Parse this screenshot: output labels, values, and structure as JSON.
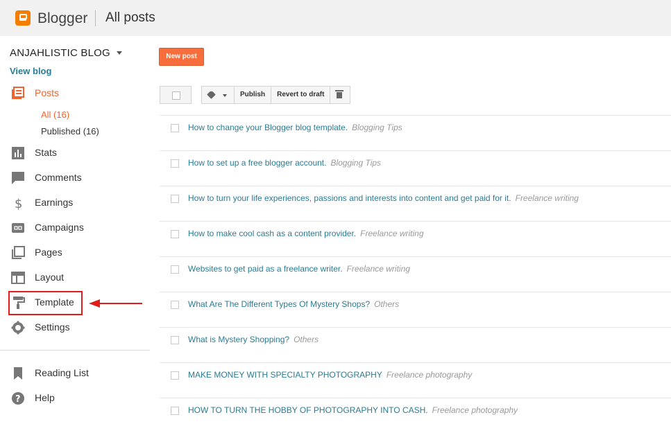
{
  "header": {
    "brand": "Blogger",
    "page_title": "All posts"
  },
  "sidebar": {
    "blog_name": "ANJAHLISTIC BLOG",
    "view_blog": "View blog",
    "posts": "Posts",
    "sub_items": [
      {
        "label": "All (16)"
      },
      {
        "label": "Published (16)"
      }
    ],
    "items": [
      {
        "label": "Stats"
      },
      {
        "label": "Comments"
      },
      {
        "label": "Earnings"
      },
      {
        "label": "Campaigns"
      },
      {
        "label": "Pages"
      },
      {
        "label": "Layout"
      },
      {
        "label": "Template"
      },
      {
        "label": "Settings"
      }
    ],
    "bottom_items": [
      {
        "label": "Reading List"
      },
      {
        "label": "Help"
      }
    ]
  },
  "toolbar": {
    "new_post": "New post",
    "publish": "Publish",
    "revert": "Revert to draft"
  },
  "posts": [
    {
      "title": "How to change your Blogger blog template.",
      "label": "Blogging Tips"
    },
    {
      "title": "How to set up a free blogger account.",
      "label": "Blogging Tips"
    },
    {
      "title": "How to turn your life experiences, passions and interests into content and get paid for it.",
      "label": "Freelance writing"
    },
    {
      "title": "How to make cool cash as a content provider.",
      "label": "Freelance writing"
    },
    {
      "title": "Websites to get paid as a freelance writer.",
      "label": "Freelance writing"
    },
    {
      "title": "What Are The Different Types Of Mystery Shops?",
      "label": "Others"
    },
    {
      "title": "What is Mystery Shopping?",
      "label": "Others"
    },
    {
      "title": "MAKE MONEY WITH SPECIALTY PHOTOGRAPHY",
      "label": "Freelance photography"
    },
    {
      "title": "HOW TO TURN THE HOBBY OF PHOTOGRAPHY INTO CASH.",
      "label": "Freelance photography"
    }
  ],
  "colors": {
    "accent": "#f1622c",
    "link": "#2a7b94",
    "highlight": "#e21b1b",
    "topbar": "#f1f1f1"
  }
}
